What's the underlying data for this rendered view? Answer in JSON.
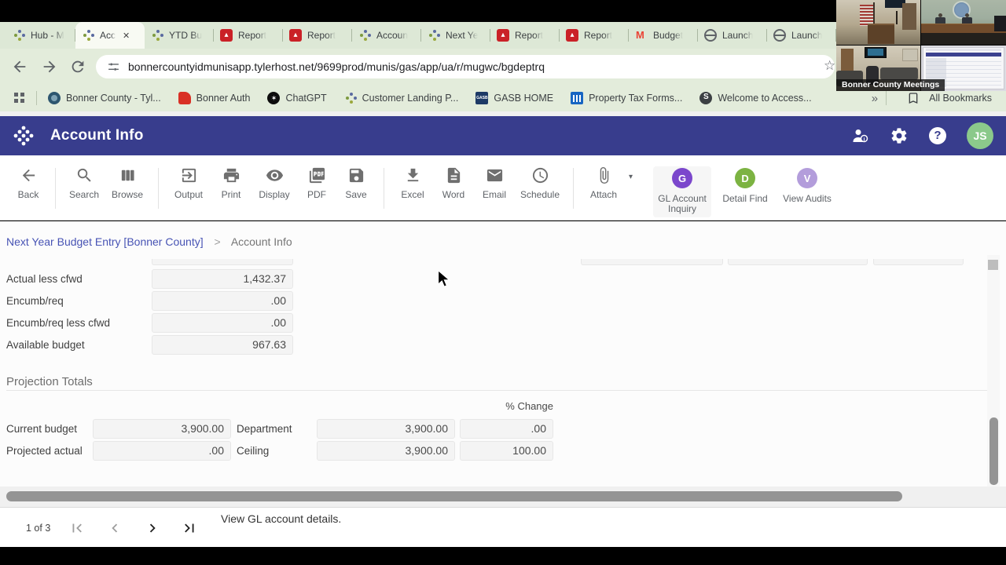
{
  "browser": {
    "tab_strip": {
      "tabs": [
        {
          "label": "Hub - M",
          "icon": "tyler-favicon"
        },
        {
          "label": "Acc",
          "icon": "tyler-favicon",
          "active": true
        },
        {
          "label": "YTD Bu",
          "icon": "tyler-favicon"
        },
        {
          "label": "Report",
          "icon": "pdf-favicon"
        },
        {
          "label": "Report",
          "icon": "pdf-favicon"
        },
        {
          "label": "Accoun",
          "icon": "tyler-favicon"
        },
        {
          "label": "Next Ye",
          "icon": "tyler-favicon"
        },
        {
          "label": "Report",
          "icon": "pdf-favicon"
        },
        {
          "label": "Report",
          "icon": "pdf-favicon"
        },
        {
          "label": "Budget",
          "icon": "gmail-favicon"
        },
        {
          "label": "Launch",
          "icon": "globe-favicon"
        },
        {
          "label": "Launch",
          "icon": "globe-favicon"
        }
      ],
      "close_glyph": "✕"
    },
    "address_bar": {
      "url": "bonnercountyidmunisapp.tylerhost.net/9699prod/munis/gas/app/ua/r/mugwc/bgdeptrq"
    },
    "bookmarks_bar": {
      "items": [
        {
          "label": "Bonner County - Tyl...",
          "icon": "county-seal-favicon"
        },
        {
          "label": "Bonner Auth",
          "icon": "red-favicon"
        },
        {
          "label": "ChatGPT",
          "icon": "chatgpt-favicon"
        },
        {
          "label": "Customer Landing P...",
          "icon": "tyler-favicon"
        },
        {
          "label": "GASB HOME",
          "icon": "gasb-favicon"
        },
        {
          "label": "Property Tax Forms...",
          "icon": "columns-favicon"
        },
        {
          "label": "Welcome to Access...",
          "icon": "globe-dark-favicon"
        }
      ],
      "overflow_glyph": "»",
      "all_bookmarks": "All Bookmarks"
    }
  },
  "webcam_overlay": {
    "label": "Bonner County Meetings"
  },
  "app_header": {
    "title": "Account Info",
    "avatar_initials": "JS",
    "help_glyph": "?"
  },
  "ribbon": {
    "items": [
      {
        "label": "Back"
      },
      {
        "label": "Search"
      },
      {
        "label": "Browse"
      },
      {
        "label": "Output"
      },
      {
        "label": "Print"
      },
      {
        "label": "Display"
      },
      {
        "label": "PDF"
      },
      {
        "label": "Save"
      },
      {
        "label": "Excel"
      },
      {
        "label": "Word"
      },
      {
        "label": "Email"
      },
      {
        "label": "Schedule"
      },
      {
        "label": "Attach"
      },
      {
        "label": "GL Account Inquiry",
        "badge": "G",
        "color": "#7b47cc"
      },
      {
        "label": "Detail Find",
        "badge": "D",
        "color": "#7cb342"
      },
      {
        "label": "View Audits",
        "badge": "V",
        "color": "#b39ddb"
      }
    ],
    "attach_caret": "▾"
  },
  "breadcrumb": {
    "parent": "Next Year Budget Entry [Bonner County]",
    "separator": ">",
    "current": "Account Info"
  },
  "account_fields": [
    {
      "label": "Actual less cfwd",
      "value": "1,432.37"
    },
    {
      "label": "Encumb/req",
      "value": ".00"
    },
    {
      "label": "Encumb/req less cfwd",
      "value": ".00"
    },
    {
      "label": "Available budget",
      "value": "967.63"
    }
  ],
  "projection_totals": {
    "title": "Projection Totals",
    "pct_change_header": "% Change",
    "rows": [
      {
        "label_left": "Current budget",
        "value_left": "3,900.00",
        "label_mid": "Department",
        "value_mid": "3,900.00",
        "pct": ".00"
      },
      {
        "label_left": "Projected actual",
        "value_left": ".00",
        "label_mid": "Ceiling",
        "value_mid": "3,900.00",
        "pct": "100.00"
      }
    ]
  },
  "footer": {
    "page_indicator": "1 of 3",
    "status_text": "View GL account details."
  },
  "colors": {
    "header_bg": "#383d8d",
    "chrome_bg": "#dde8d6",
    "avatar_bg": "#8bc98b",
    "gl_badge": "#7b47cc",
    "detail_find_badge": "#7cb342",
    "view_audits_badge": "#b39ddb"
  }
}
